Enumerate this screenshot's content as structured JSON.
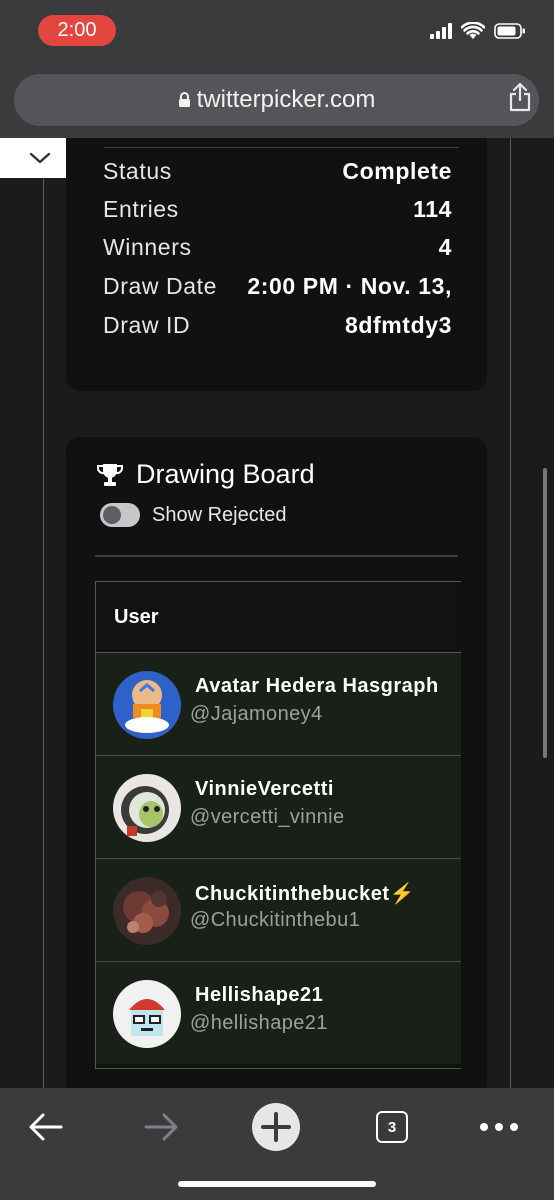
{
  "status_bar": {
    "time": "2:00"
  },
  "browser": {
    "url": "twitterpicker.com",
    "tabs_count": "3"
  },
  "summary": [
    {
      "label": "Status",
      "value": "Complete"
    },
    {
      "label": "Entries",
      "value": "114"
    },
    {
      "label": "Winners",
      "value": "4"
    },
    {
      "label": "Draw Date",
      "value": "2:00 PM · Nov. 13,"
    },
    {
      "label": "Draw ID",
      "value": "8dfmtdy3"
    }
  ],
  "drawing_board": {
    "title": "Drawing Board",
    "toggle_label": "Show Rejected",
    "toggle_on": false,
    "column_header": "User",
    "users": [
      {
        "name": "Avatar Hedera Hasgraph",
        "handle": "@Jajamoney4"
      },
      {
        "name": "VinnieVercetti",
        "handle": "@vercetti_vinnie"
      },
      {
        "name": "Chuckitinthebucket⚡",
        "handle": "@Chuckitinthebu1"
      },
      {
        "name": "Hellishape21",
        "handle": "@hellishape21"
      }
    ]
  },
  "icons": {
    "lock": "lock-icon",
    "share": "share-icon",
    "chevron": "chevron-down-icon",
    "trophy": "trophy-icon",
    "back": "back-arrow-icon",
    "forward": "forward-arrow-icon",
    "new_tab": "plus-icon",
    "more": "more-icon"
  },
  "colors": {
    "time_pill": "#e2463f",
    "row_bg": "#182018",
    "card_bg": "#111112"
  }
}
